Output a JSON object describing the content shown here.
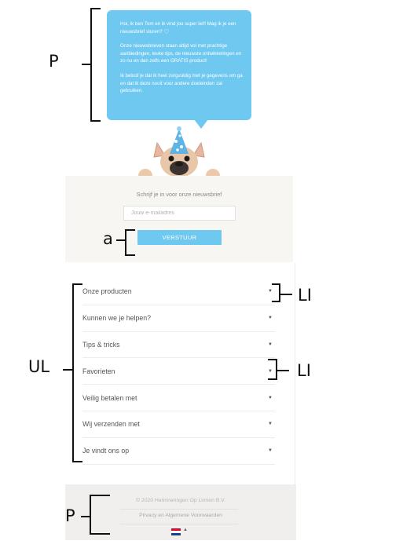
{
  "annotations": {
    "p_top": "P",
    "a": "a",
    "li_first": "LI",
    "ul": "UL",
    "li_second": "LI",
    "p_bottom": "P"
  },
  "bubble": {
    "greeting": "Hoi, ik ben Tom en ik vind jou super lief! Mag ik je een nieuwsbrief sturen?",
    "heart_icon": "heart-outline-icon",
    "body": "Onze nieuwsbrieven staan altijd vol met prachtige aanbiedingen, leuke tips, de nieuwste ontwikkelingen en zo nu en dan zelfs een GRATIS product!",
    "promise": "Ik beloof je dat ik heel zorgvuldig met je gegevens om ga en dat ik deze nooit voor andere doeleinden zal gebruiken.",
    "color": "#6ec8f0"
  },
  "newsletter": {
    "title": "Schrijf je in voor onze nieuwsbrief",
    "email_placeholder": "Jouw e-mailadres",
    "submit_label": "VERSTUUR"
  },
  "menu": {
    "items": [
      {
        "label": "Onze producten"
      },
      {
        "label": "Kunnen we je helpen?"
      },
      {
        "label": "Tips & tricks"
      },
      {
        "label": "Favorieten"
      },
      {
        "label": "Veilig betalen met"
      },
      {
        "label": "Wij verzenden met"
      },
      {
        "label": "Je vindt ons op"
      }
    ],
    "caret_icon": "caret-down-icon"
  },
  "footer": {
    "copyright": "© 2020 Herinneringen Op Linnen B.V.",
    "privacy": "Privacy en Algemene Voorwaarden",
    "flag_icon": "dutch-flag-icon"
  }
}
